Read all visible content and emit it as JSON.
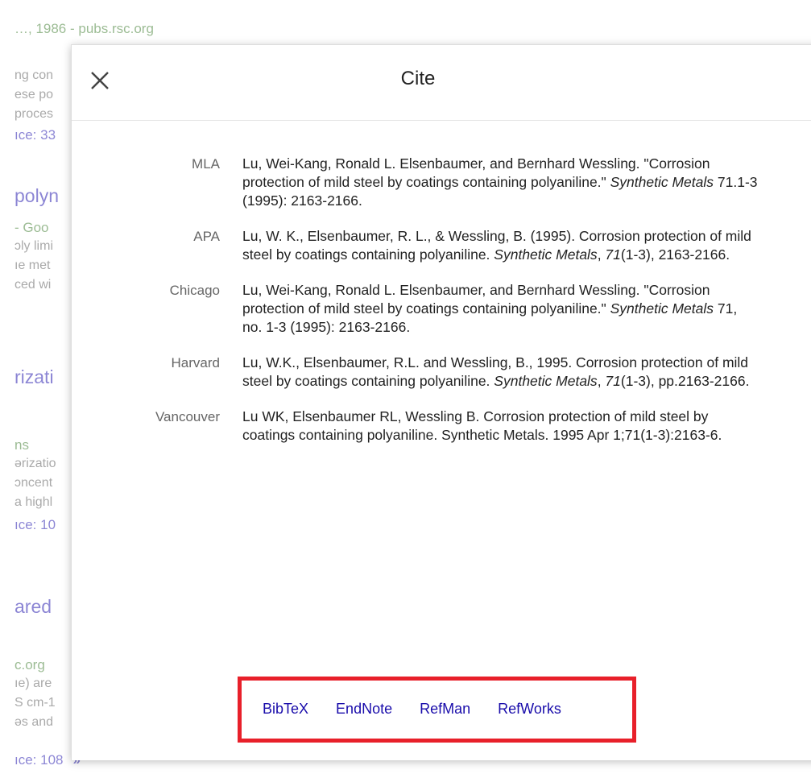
{
  "background": {
    "lines": [
      {
        "text": "…, 1986 - pubs.rsc.org",
        "kind": "meta"
      },
      {
        "text": "ng con",
        "kind": "snip"
      },
      {
        "text": "ese po",
        "kind": "snip"
      },
      {
        "text": "proces",
        "kind": "snip"
      },
      {
        "text": "ıce: 33",
        "kind": "cite"
      },
      {
        "text": "polyn",
        "kind": "title"
      },
      {
        "text": " - Goo",
        "kind": "meta"
      },
      {
        "text": "ɔly limi",
        "kind": "snip"
      },
      {
        "text": "ıe met",
        "kind": "snip"
      },
      {
        "text": "ced wi",
        "kind": "snip"
      },
      {
        "text": "rizati",
        "kind": "title"
      },
      {
        "text": "ns",
        "kind": "meta"
      },
      {
        "text": "ərizatio",
        "kind": "snip"
      },
      {
        "text": "ɔncent",
        "kind": "snip"
      },
      {
        "text": "a highl",
        "kind": "snip"
      },
      {
        "text": "ıce: 10",
        "kind": "cite"
      },
      {
        "text": "ared",
        "kind": "title"
      },
      {
        "text": "c.org",
        "kind": "meta"
      },
      {
        "text": "ıe) are",
        "kind": "snip"
      },
      {
        "text": "S cm-1",
        "kind": "snip"
      },
      {
        "text": "əs and",
        "kind": "snip"
      },
      {
        "text": "ıce: 108",
        "kind": "cite"
      }
    ],
    "more_icon": "double-chevron-icon"
  },
  "modal": {
    "title": "Cite",
    "close_icon": "close-icon",
    "citations": [
      {
        "style": "MLA",
        "parts": [
          {
            "t": "Lu, Wei-Kang, Ronald L. Elsenbaumer, and Bernhard Wessling. \"Corrosion protection of mild steel by coatings containing polyaniline.\" "
          },
          {
            "t": "Synthetic Metals",
            "i": true
          },
          {
            "t": " 71.1-3 (1995): 2163-2166."
          }
        ]
      },
      {
        "style": "APA",
        "parts": [
          {
            "t": "Lu, W. K., Elsenbaumer, R. L., & Wessling, B. (1995). Corrosion protection of mild steel by coatings containing polyaniline. "
          },
          {
            "t": "Synthetic Metals",
            "i": true
          },
          {
            "t": ", "
          },
          {
            "t": "71",
            "i": true
          },
          {
            "t": "(1-3), 2163-2166."
          }
        ]
      },
      {
        "style": "Chicago",
        "parts": [
          {
            "t": "Lu, Wei-Kang, Ronald L. Elsenbaumer, and Bernhard Wessling. \"Corrosion protection of mild steel by coatings containing polyaniline.\" "
          },
          {
            "t": "Synthetic Metals",
            "i": true
          },
          {
            "t": " 71, no. 1-3 (1995): 2163-2166."
          }
        ]
      },
      {
        "style": "Harvard",
        "parts": [
          {
            "t": "Lu, W.K., Elsenbaumer, R.L. and Wessling, B., 1995. Corrosion protection of mild steel by coatings containing polyaniline. "
          },
          {
            "t": "Synthetic Metals",
            "i": true
          },
          {
            "t": ", "
          },
          {
            "t": "71",
            "i": true
          },
          {
            "t": "(1-3), pp.2163-2166."
          }
        ]
      },
      {
        "style": "Vancouver",
        "parts": [
          {
            "t": "Lu WK, Elsenbaumer RL, Wessling B. Corrosion protection of mild steel by coatings containing polyaniline. Synthetic Metals. 1995 Apr 1;71(1-3):2163-6."
          }
        ]
      }
    ],
    "exports": [
      "BibTeX",
      "EndNote",
      "RefMan",
      "RefWorks"
    ],
    "highlight_color": "#e8202a",
    "link_color": "#1a0dab"
  }
}
